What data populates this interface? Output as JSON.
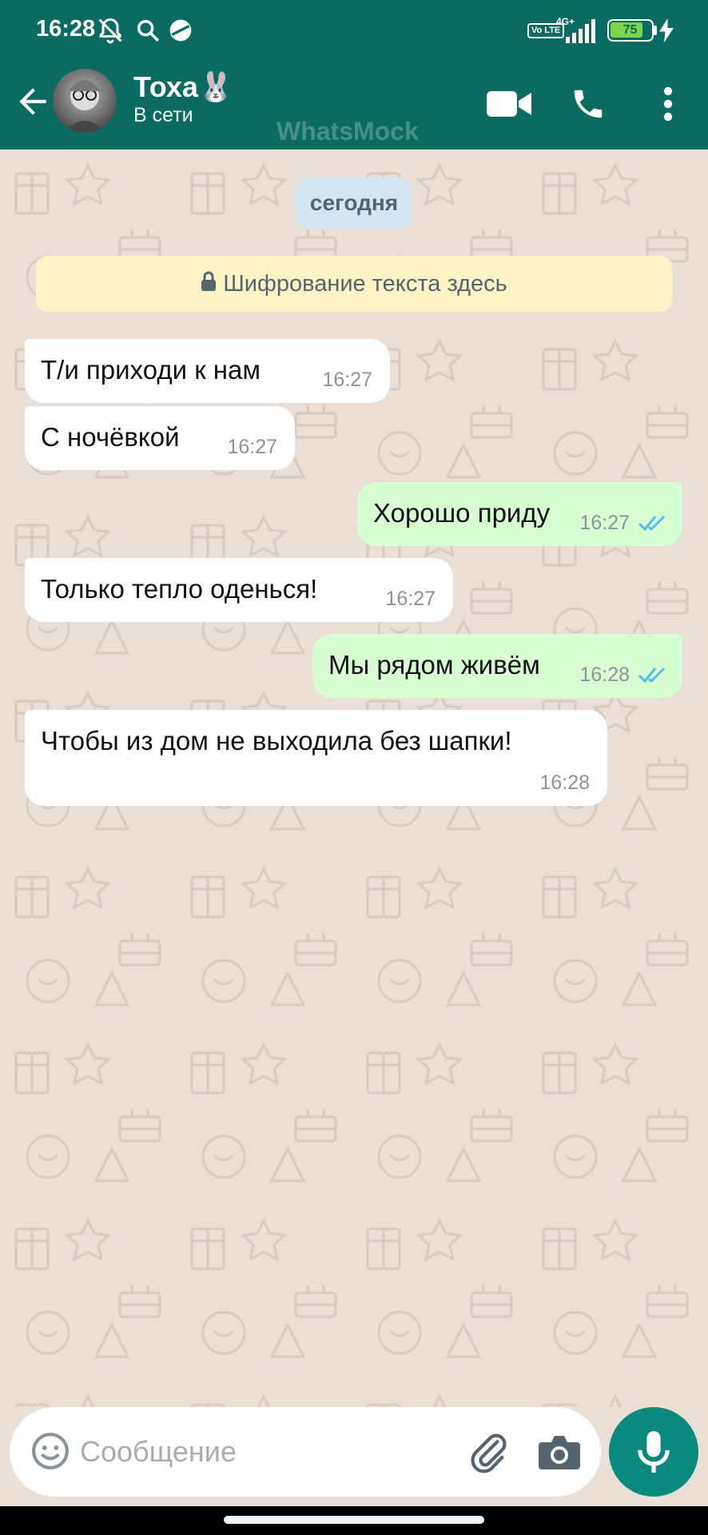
{
  "status_bar": {
    "time": "16:28",
    "battery": "75",
    "network": "4G+",
    "volte": "Vo LTE"
  },
  "header": {
    "contact_name": "Тоха🐰",
    "presence": "В сети",
    "watermark": "WhatsMock"
  },
  "chat": {
    "date_chip": "сегодня",
    "encryption_notice": "Шифрование текста здесь",
    "messages": [
      {
        "direction": "in",
        "text": "Т/и приходи к нам",
        "time": "16:27"
      },
      {
        "direction": "in",
        "text": "С ночёвкой",
        "time": "16:27"
      },
      {
        "direction": "out",
        "text": "Хорошо приду",
        "time": "16:27",
        "read": true
      },
      {
        "direction": "in",
        "text": "Только тепло оденься!",
        "time": "16:27"
      },
      {
        "direction": "out",
        "text": "Мы рядом живём",
        "time": "16:28",
        "read": true
      },
      {
        "direction": "in",
        "text": "Чтобы из дом не выходила без шапки!",
        "time": "16:28"
      }
    ]
  },
  "composer": {
    "placeholder": "Сообщение"
  },
  "colors": {
    "header": "#0a6b61",
    "chat_bg": "#e9dfd6",
    "incoming": "#ffffff",
    "outgoing": "#d9fdd3",
    "read_ticks": "#53bdeb",
    "mic_button": "#0a8a7d"
  },
  "icons": [
    "back-arrow-icon",
    "video-call-icon",
    "voice-call-icon",
    "more-options-icon",
    "lock-icon",
    "emoji-icon",
    "attach-icon",
    "camera-icon",
    "mic-icon",
    "double-check-icon"
  ]
}
